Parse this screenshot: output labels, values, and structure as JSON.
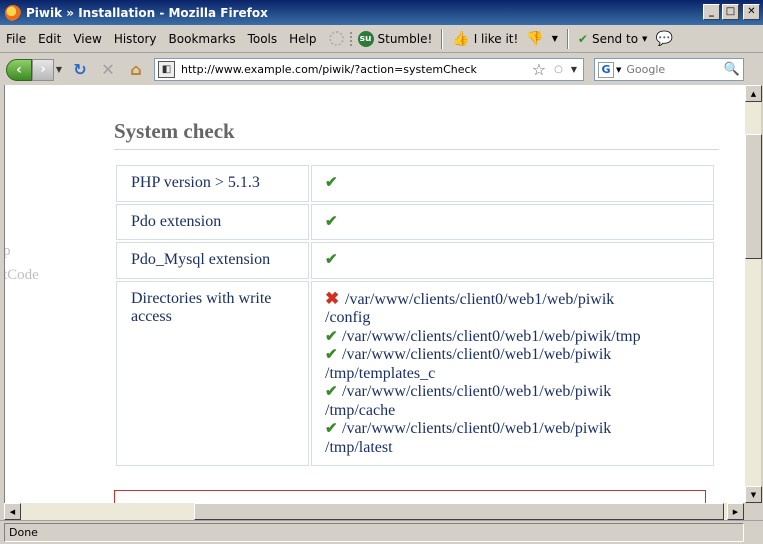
{
  "window": {
    "title": "Piwik » Installation - Mozilla Firefox"
  },
  "menu": {
    "items": [
      "File",
      "Edit",
      "View",
      "History",
      "Bookmarks",
      "Tools",
      "Help"
    ],
    "toolbar": {
      "stumble": "Stumble!",
      "like": "I like it!",
      "send": "Send to"
    }
  },
  "nav": {
    "url": "http://www.example.com/piwik/?action=systemCheck",
    "search_placeholder": "Google"
  },
  "page": {
    "ghost_text": [
      "p",
      "tCode"
    ],
    "heading": "System check",
    "checks": [
      {
        "label": "PHP version > 5.1.3",
        "status": "ok"
      },
      {
        "label": "Pdo extension",
        "status": "ok"
      },
      {
        "label": "Pdo_Mysql extension",
        "status": "ok"
      }
    ],
    "directories": {
      "label": "Directories with write access",
      "lines": [
        {
          "status": "error",
          "text": "/var/www/clients/client0/web1/web/piwik",
          "cont": "/config"
        },
        {
          "status": "ok",
          "text": "/var/www/clients/client0/web1/web/piwik/tmp",
          "cont": ""
        },
        {
          "status": "ok",
          "text": "/var/www/clients/client0/web1/web/piwik",
          "cont": "/tmp/templates_c"
        },
        {
          "status": "ok",
          "text": "/var/www/clients/client0/web1/web/piwik",
          "cont": "/tmp/cache"
        },
        {
          "status": "ok",
          "text": "/var/www/clients/client0/web1/web/piwik",
          "cont": "/tmp/latest"
        }
      ]
    }
  },
  "status": {
    "text": "Done"
  },
  "colors": {
    "ok": "#3c8a2e",
    "error": "#d03020",
    "text": "#1a3060"
  }
}
